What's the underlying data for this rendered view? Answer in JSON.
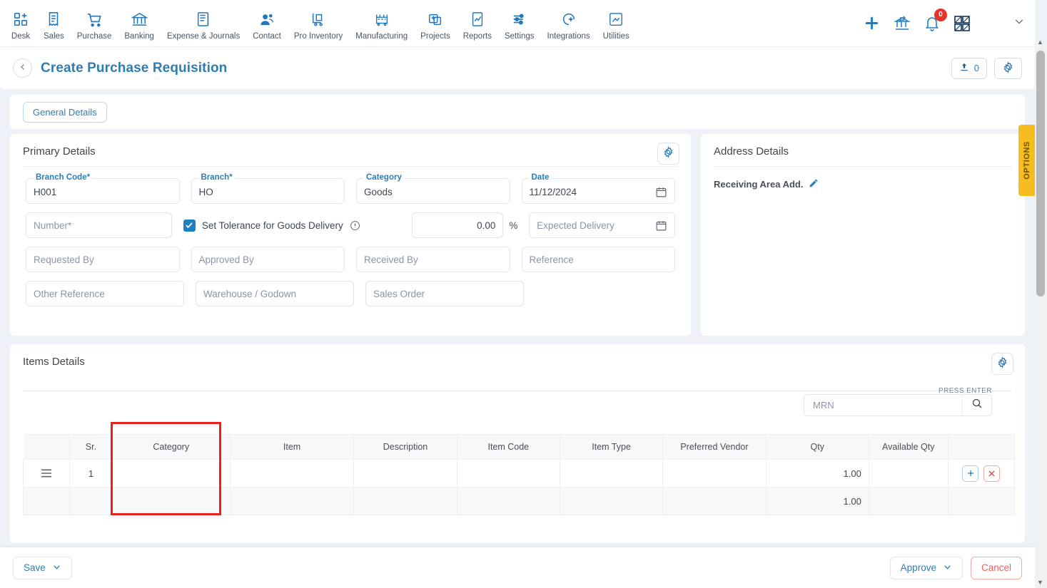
{
  "topnav": {
    "items": [
      {
        "label": "Desk",
        "icon": "dashboard-icon"
      },
      {
        "label": "Sales",
        "icon": "receipt-icon"
      },
      {
        "label": "Purchase",
        "icon": "cart-icon"
      },
      {
        "label": "Banking",
        "icon": "bank-icon"
      },
      {
        "label": "Expense & Journals",
        "icon": "journal-icon"
      },
      {
        "label": "Contact",
        "icon": "people-icon"
      },
      {
        "label": "Pro Inventory",
        "icon": "trolley-icon"
      },
      {
        "label": "Manufacturing",
        "icon": "factory-icon"
      },
      {
        "label": "Projects",
        "icon": "clipboard-icon"
      },
      {
        "label": "Reports",
        "icon": "report-chart-icon"
      },
      {
        "label": "Settings",
        "icon": "sliders-icon"
      },
      {
        "label": "Integrations",
        "icon": "plug-icon"
      },
      {
        "label": "Utilities",
        "icon": "utilities-icon"
      }
    ],
    "right": {
      "add_icon": "plus-icon",
      "transfer_icon": "bank-transfer-icon",
      "bell_icon": "bell-icon",
      "notification_count": "0",
      "apps_icon": "apps-grid-icon",
      "caret_icon": "chevron-down-icon"
    }
  },
  "header": {
    "back_icon": "chevron-left-icon",
    "title": "Create Purchase Requisition",
    "attachment_icon": "upload-icon",
    "attachment_count": "0",
    "settings_icon": "gear-icon"
  },
  "tabs": [
    {
      "label": "General Details",
      "active": true
    }
  ],
  "primary": {
    "title": "Primary Details",
    "settings_icon": "gear-icon",
    "fields": {
      "branch_code": {
        "label": "Branch Code",
        "required": true,
        "value": "H001"
      },
      "branch": {
        "label": "Branch",
        "required": true,
        "value": "HO"
      },
      "category": {
        "label": "Category",
        "required": false,
        "value": "Goods"
      },
      "date": {
        "label": "Date",
        "required": false,
        "value": "11/12/2024",
        "icon": "calendar-icon"
      },
      "number": {
        "placeholder": "Number",
        "required": true,
        "value": ""
      },
      "tolerance": {
        "label": "Set Tolerance for Goods Delivery",
        "checked": true,
        "info_icon": "info-icon"
      },
      "tolerance_pct": {
        "value": "0.00",
        "unit": "%"
      },
      "expected_delivery": {
        "placeholder": "Expected Delivery",
        "value": "",
        "icon": "calendar-icon"
      },
      "requested_by": {
        "placeholder": "Requested By",
        "value": ""
      },
      "approved_by": {
        "placeholder": "Approved By",
        "value": ""
      },
      "received_by": {
        "placeholder": "Received By",
        "value": ""
      },
      "reference": {
        "placeholder": "Reference",
        "value": ""
      },
      "other_reference": {
        "placeholder": "Other Reference",
        "value": ""
      },
      "warehouse": {
        "placeholder": "Warehouse / Godown",
        "value": ""
      },
      "sales_order": {
        "placeholder": "Sales Order",
        "value": ""
      }
    }
  },
  "address": {
    "title": "Address Details",
    "receiving_area_label": "Receiving Area Add.",
    "edit_icon": "pencil-icon"
  },
  "options_tab": {
    "label": "OPTIONS"
  },
  "items": {
    "title": "Items Details",
    "settings_icon": "gear-icon",
    "press_enter_hint": "PRESS ENTER",
    "search": {
      "placeholder": "MRN",
      "value": "",
      "icon": "search-icon"
    },
    "columns": [
      "",
      "Sr.",
      "Category",
      "Item",
      "Description",
      "Item Code",
      "Item Type",
      "Preferred Vendor",
      "Qty",
      "Available Qty",
      ""
    ],
    "rows": [
      {
        "drag_icon": "drag-handle-icon",
        "sr": "1",
        "category": "",
        "item": "",
        "description": "",
        "item_code": "",
        "item_type": "",
        "preferred_vendor": "",
        "qty": "1.00",
        "available_qty": "",
        "add_icon": "plus-icon",
        "delete_icon": "close-icon"
      },
      {
        "drag_icon": "",
        "sr": "",
        "category": "",
        "item": "",
        "description": "",
        "item_code": "",
        "item_type": "",
        "preferred_vendor": "",
        "qty": "1.00",
        "available_qty": "",
        "add_icon": "",
        "delete_icon": ""
      }
    ],
    "highlight": {
      "color": "#e8201a",
      "target_column": "Category"
    }
  },
  "footer": {
    "save_label": "Save",
    "save_caret": "chevron-down-icon",
    "approve_label": "Approve",
    "approve_caret": "chevron-down-icon",
    "cancel_label": "Cancel"
  }
}
